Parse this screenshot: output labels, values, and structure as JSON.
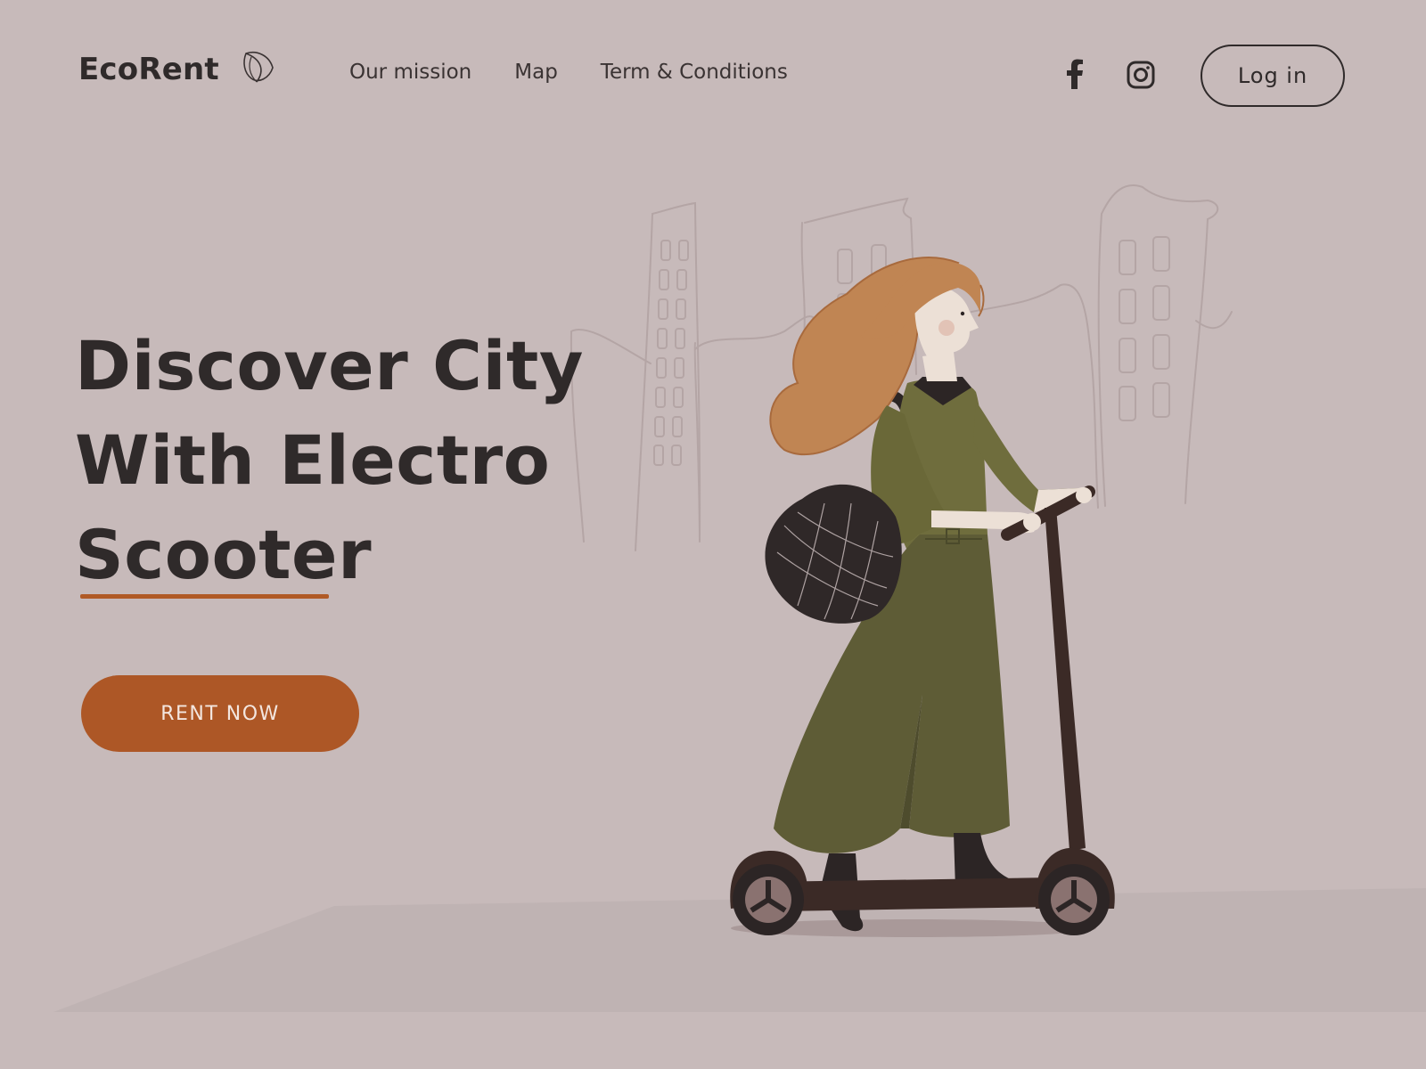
{
  "brand": {
    "name": "EcoRent"
  },
  "nav": {
    "items": [
      {
        "label": "Our mission"
      },
      {
        "label": "Map"
      },
      {
        "label": "Term & Conditions"
      }
    ]
  },
  "social": {
    "icons": [
      "facebook-icon",
      "instagram-icon"
    ]
  },
  "header": {
    "login_label": "Log  in"
  },
  "hero": {
    "title_lines": [
      "Discover City",
      "With Electro",
      "Scooter"
    ],
    "cta_label": "RENT NOW"
  },
  "colors": {
    "background": "#c7baba",
    "text": "#2f2a2a",
    "accent": "#ad5726",
    "outfit": "#6f6d3d",
    "hair": "#c08553"
  }
}
